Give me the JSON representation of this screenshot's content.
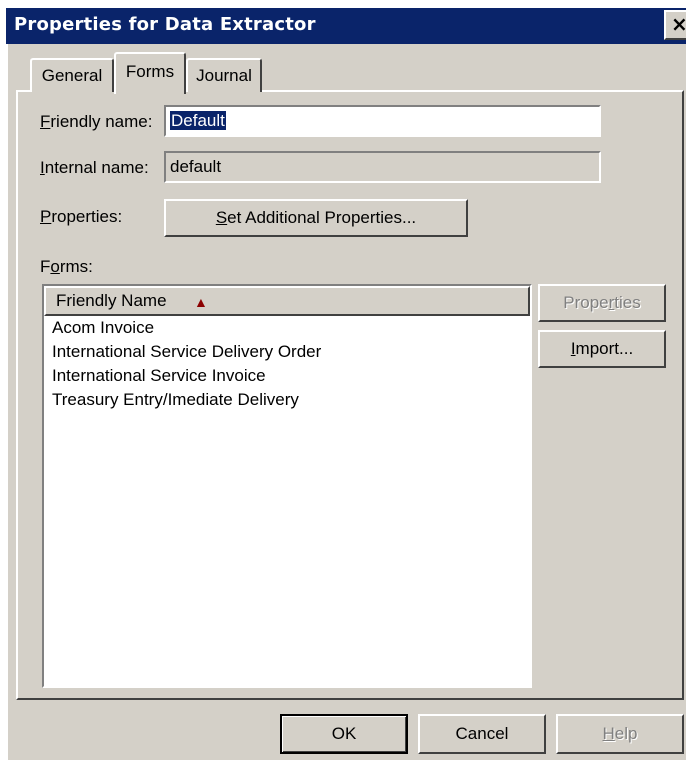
{
  "window": {
    "title": "Properties for Data Extractor",
    "close_glyph": "×"
  },
  "tabs": [
    {
      "label": "General",
      "active": false
    },
    {
      "label": "Forms",
      "active": true
    },
    {
      "label": "Journal",
      "active": false
    }
  ],
  "fields": {
    "friendly_name": {
      "label_mnemonic": "F",
      "label_rest": "riendly name:",
      "value": "Default"
    },
    "internal_name": {
      "label_mnemonic": "I",
      "label_rest": "nternal name:",
      "value": "default"
    },
    "properties": {
      "label_mnemonic": "P",
      "label_rest": "roperties:"
    }
  },
  "buttons": {
    "set_additional_pre": "",
    "set_additional_mnemonic": "S",
    "set_additional_rest": "et Additional Properties...",
    "properties_pre": "Prope",
    "properties_mnemonic": "r",
    "properties_rest": "ties",
    "import_mnemonic": "I",
    "import_rest": "mport...",
    "ok": "OK",
    "cancel": "Cancel",
    "help_mnemonic": "H",
    "help_rest": "elp"
  },
  "forms_section": {
    "label_pre": "F",
    "label_mnemonic": "o",
    "label_rest": "rms:",
    "column_header": "Friendly Name",
    "sort_glyph": "▲",
    "items": [
      "Acom Invoice",
      "International Service Delivery Order",
      "International Service Invoice",
      "Treasury Entry/Imediate Delivery"
    ]
  },
  "colors": {
    "titlebar": "#0a246a",
    "dialog_bg": "#d4d0c8",
    "sort_arrow": "#8b0000"
  }
}
